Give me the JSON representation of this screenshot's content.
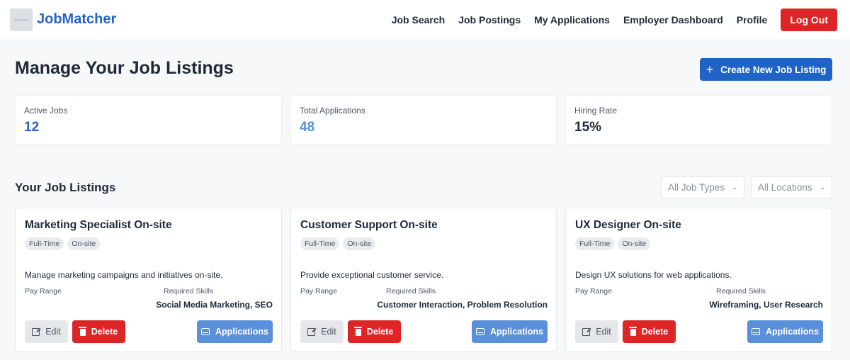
{
  "brand": {
    "name": "JobMatcher"
  },
  "nav": {
    "links": [
      "Job Search",
      "Job Postings",
      "My Applications",
      "Employer Dashboard",
      "Profile"
    ],
    "logout_label": "Log Out"
  },
  "page": {
    "title": "Manage Your Job Listings",
    "create_label": "Create New Job Listing"
  },
  "stats": [
    {
      "label": "Active Jobs",
      "value": "12",
      "color": "#2563c6"
    },
    {
      "label": "Total Applications",
      "value": "48",
      "color": "#5b8fd9"
    },
    {
      "label": "Hiring Rate",
      "value": "15%",
      "color": "#1f2a37"
    }
  ],
  "listings": {
    "title": "Your Job Listings",
    "filters": [
      "All Job Types",
      "All Locations"
    ],
    "cards": [
      {
        "title": "Marketing Specialist On-site",
        "tags": [
          "Full-Time",
          "On-site"
        ],
        "description": "Manage marketing campaigns and initiatives on-site.",
        "pay_label": "Pay Range",
        "skills_label": "Required Skills",
        "skills": "Social Media Marketing, SEO",
        "edit_label": "Edit",
        "delete_label": "Delete",
        "applications_label": "Applications"
      },
      {
        "title": "Customer Support On-site",
        "tags": [
          "Full-Time",
          "On-site"
        ],
        "description": "Provide exceptional customer service.",
        "pay_label": "Pay Range",
        "skills_label": "Required Skills",
        "skills": "Customer Interaction, Problem Resolution",
        "edit_label": "Edit",
        "delete_label": "Delete",
        "applications_label": "Applications"
      },
      {
        "title": "UX Designer On-site",
        "tags": [
          "Full-Time",
          "On-site"
        ],
        "description": "Design UX solutions for web applications.",
        "pay_label": "Pay Range",
        "skills_label": "Required Skills",
        "skills": "Wireframing, User Research",
        "edit_label": "Edit",
        "delete_label": "Delete",
        "applications_label": "Applications"
      }
    ]
  },
  "colors": {
    "primary": "#1f63c6",
    "danger": "#dc2626",
    "secondary": "#5b8fd9"
  }
}
